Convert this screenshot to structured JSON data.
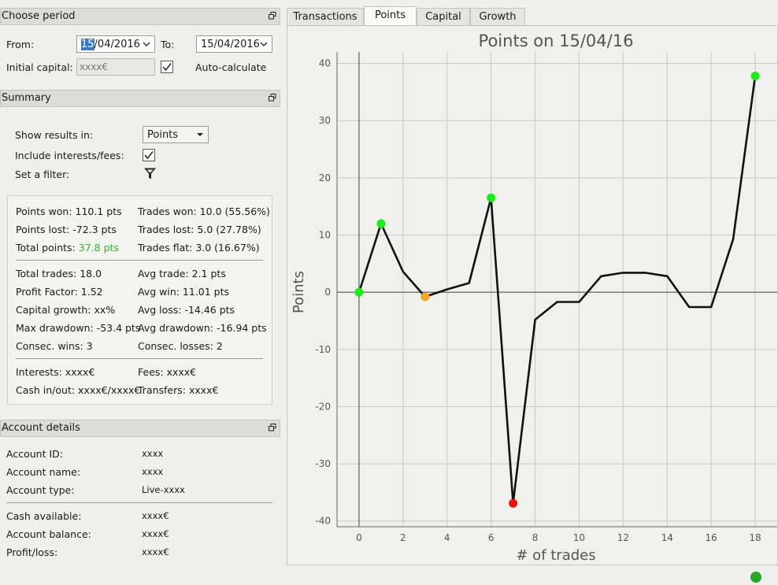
{
  "period": {
    "title": "Choose period",
    "from_label": "From:",
    "from_day_selected": "15",
    "from_rest": "/04/2016",
    "to_label": "To:",
    "to_value": "15/04/2016",
    "initial_capital_label": "Initial capital:",
    "initial_capital_placeholder": "xxxx€",
    "auto_calculate_checked": true,
    "auto_calculate_label": "Auto-calculate"
  },
  "summary": {
    "title": "Summary",
    "show_results_label": "Show results in:",
    "show_results_value": "Points",
    "include_interests_label": "Include interests/fees:",
    "include_interests_checked": true,
    "set_filter_label": "Set a filter:",
    "stats": {
      "points_won": "Points won: 110.1 pts",
      "trades_won": "Trades won: 10.0 (55.56%)",
      "points_lost": "Points lost: -72.3 pts",
      "trades_lost": "Trades lost: 5.0 (27.78%)",
      "total_points_label": "Total points:",
      "total_points_value": "37.8 pts",
      "trades_flat": "Trades flat: 3.0 (16.67%)",
      "total_trades": "Total trades: 18.0",
      "avg_trade": "Avg trade: 2.1 pts",
      "profit_factor": "Profit Factor: 1.52",
      "avg_win": "Avg win: 11.01 pts",
      "capital_growth": "Capital growth: xx%",
      "avg_loss": "Avg loss: -14.46 pts",
      "max_drawdown": "Max drawdown: -53.4 pts",
      "avg_drawdown": "Avg drawdown: -16.94 pts",
      "consec_wins": "Consec. wins: 3",
      "consec_losses": "Consec. losses: 2",
      "interests": "Interests: xxxx€",
      "fees": "Fees: xxxx€",
      "cash_in_out": "Cash in/out: xxxx€/xxxx€",
      "transfers": "Transfers: xxxx€"
    }
  },
  "account": {
    "title": "Account details",
    "rows": [
      {
        "label": "Account ID:",
        "value": "xxxx"
      },
      {
        "label": "Account name:",
        "value": "xxxx"
      },
      {
        "label": "Account type:",
        "value": "Live-xxxx"
      },
      {
        "label": "Cash available:",
        "value": "xxxx€"
      },
      {
        "label": "Account balance:",
        "value": "xxxx€"
      },
      {
        "label": "Profit/loss:",
        "value": "xxxx€"
      }
    ]
  },
  "tabs": [
    {
      "label": "Transactions",
      "active": false
    },
    {
      "label": "Points",
      "active": true
    },
    {
      "label": "Capital",
      "active": false
    },
    {
      "label": "Growth",
      "active": false
    }
  ],
  "status": {
    "indicator_color": "#2aa52a"
  },
  "colors": {
    "point_green": "#1aee1a",
    "point_orange": "#f5a623",
    "point_red": "#ee1111",
    "total_points_text": "#31b42d"
  },
  "chart_data": {
    "type": "line",
    "title": "Points on 15/04/16",
    "xlabel": "# of trades",
    "ylabel": "Points",
    "xlim": [
      -1,
      19
    ],
    "ylim": [
      -41,
      42
    ],
    "xticks": [
      0,
      2,
      4,
      6,
      8,
      10,
      12,
      14,
      16,
      18
    ],
    "yticks": [
      -40,
      -30,
      -20,
      -10,
      0,
      10,
      20,
      30,
      40
    ],
    "grid": true,
    "x": [
      0,
      1,
      2,
      3,
      4,
      5,
      6,
      7,
      8,
      9,
      10,
      11,
      12,
      13,
      14,
      15,
      16,
      17,
      18
    ],
    "values": [
      0,
      12.0,
      3.6,
      -0.8,
      0.5,
      1.6,
      16.5,
      -36.9,
      -4.8,
      -1.7,
      -1.7,
      2.8,
      3.4,
      3.4,
      2.8,
      -2.6,
      -2.6,
      9.3,
      37.8
    ],
    "markers": [
      {
        "x": 0,
        "y": 0,
        "color": "green"
      },
      {
        "x": 1,
        "y": 12.0,
        "color": "green"
      },
      {
        "x": 3,
        "y": -0.8,
        "color": "orange"
      },
      {
        "x": 6,
        "y": 16.5,
        "color": "green"
      },
      {
        "x": 7,
        "y": -36.9,
        "color": "red"
      },
      {
        "x": 18,
        "y": 37.8,
        "color": "green"
      }
    ]
  }
}
